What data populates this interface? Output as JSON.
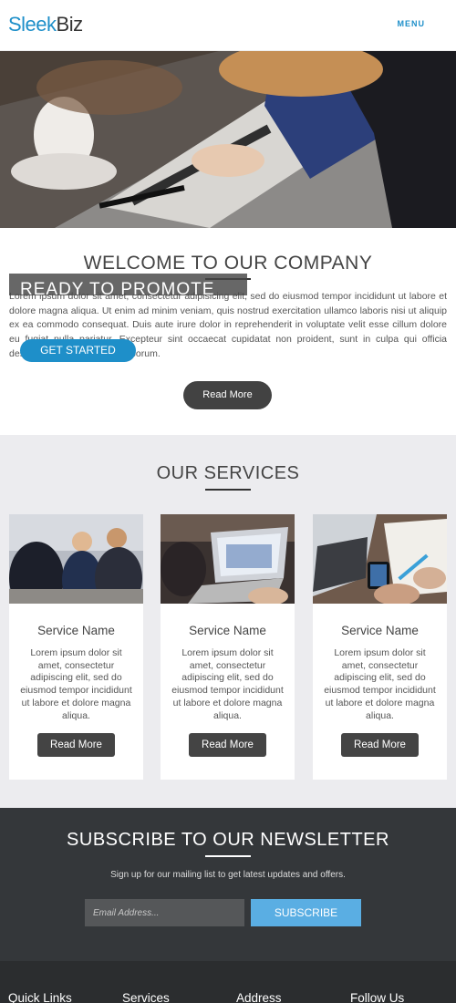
{
  "header": {
    "logo_part1": "Sleek",
    "logo_part2": "Biz",
    "menu_label": "MENU"
  },
  "welcome": {
    "title": "WELCOME TO OUR COMPANY",
    "text": "Lorem ipsum dolor sit amet, consectetur adipisicing elit, sed do eiusmod tempor incididunt ut labore et dolore magna aliqua. Ut enim ad minim veniam, quis nostrud exercitation ullamco laboris nisi ut aliquip ex ea commodo consequat. Duis aute irure dolor in reprehenderit in voluptate velit esse cillum dolore eu fugiat nulla pariatur. Excepteur sint occaecat cupidatat non proident, sunt in culpa qui officia deserunt mollit anim id est laborum.",
    "overlay_heading": "READY TO PROMOTE",
    "cta_label": "GET STARTED",
    "read_more_label": "Read More"
  },
  "services": {
    "title": "OUR SERVICES",
    "items": [
      {
        "name": "Service Name",
        "description": "Lorem ipsum dolor sit amet, consectetur adipiscing elit, sed do eiusmod tempor incididunt ut labore et dolore magna aliqua.",
        "button": "Read More"
      },
      {
        "name": "Service Name",
        "description": "Lorem ipsum dolor sit amet, consectetur adipiscing elit, sed do eiusmod tempor incididunt ut labore et dolore magna aliqua.",
        "button": "Read More"
      },
      {
        "name": "Service Name",
        "description": "Lorem ipsum dolor sit amet, consectetur adipiscing elit, sed do eiusmod tempor incididunt ut labore et dolore magna aliqua.",
        "button": "Read More"
      }
    ]
  },
  "newsletter": {
    "title": "SUBSCRIBE TO OUR NEWSLETTER",
    "text": "Sign up for our mailing list to get latest updates and offers.",
    "email_placeholder": "Email Address...",
    "button": "SUBSCRIBE"
  },
  "footer": {
    "columns": [
      "Quick Links",
      "Services",
      "Address",
      "Follow Us"
    ]
  },
  "colors": {
    "brand_blue": "#1e8fc9",
    "subscribe_blue": "#5aaee3",
    "dark_section": "#34373a",
    "services_bg": "#ececef"
  }
}
